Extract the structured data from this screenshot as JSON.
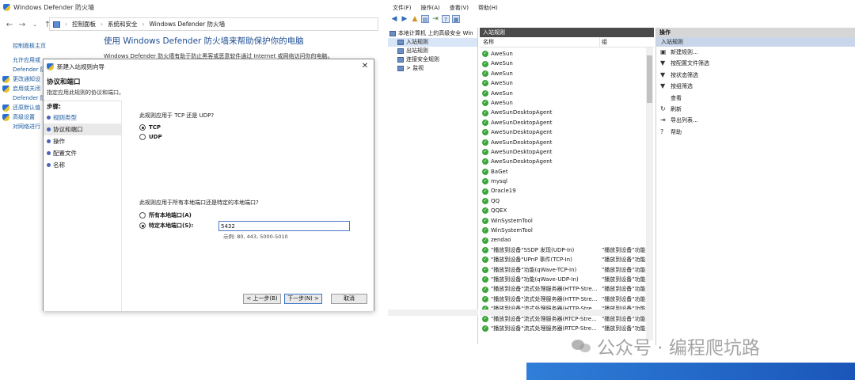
{
  "control_panel": {
    "title": "Windows Defender 防火墙",
    "path": [
      "控制面板",
      "系统和安全",
      "Windows Defender 防火墙"
    ],
    "left_links": [
      {
        "label": "控制面板主页",
        "icon": false
      },
      {
        "label": "允许应用或",
        "icon": false
      },
      {
        "label": "Defender 防",
        "icon": false
      },
      {
        "label": "更改通知设",
        "icon": true
      },
      {
        "label": "启用或关闭",
        "icon": true
      },
      {
        "label": "Defender 防",
        "icon": false
      },
      {
        "label": "还原默认值",
        "icon": true
      },
      {
        "label": "高级设置",
        "icon": true
      },
      {
        "label": "对网络进行",
        "icon": false
      }
    ],
    "heading": "使用 Windows Defender 防火墙来帮助保护你的电脑",
    "description": "Windows Defender 防火墙有助于防止黑客或恶意软件通过 Internet 或网络访问你的电脑。"
  },
  "wizard": {
    "title": "新建入站规则向导",
    "close_label": "✕",
    "header_title": "协议和端口",
    "header_subtitle": "指定应用此规则的协议和端口。",
    "steps_title": "步骤:",
    "steps": [
      "规则类型",
      "协议和端口",
      "操作",
      "配置文件",
      "名称"
    ],
    "q_protocol": "此规则应用于 TCP 还是 UDP?",
    "opt_tcp": "TCP",
    "opt_udp": "UDP",
    "q_ports": "此规则应用于所有本地端口还是特定的本地端口?",
    "opt_all_ports": "所有本地端口(A)",
    "opt_specific_ports": "特定本地端口(S):",
    "port_value": "5432",
    "port_example": "示例: 80, 443, 5000-5010",
    "btn_back": "< 上一步(B)",
    "btn_next": "下一步(N) >",
    "btn_cancel": "取消"
  },
  "mmc": {
    "menu": [
      "文件(F)",
      "操作(A)",
      "查看(V)",
      "帮助(H)"
    ],
    "tree": [
      {
        "label": "本地计算机 上的高级安全 Win",
        "indent": 0,
        "selected": false
      },
      {
        "label": "入站规则",
        "indent": 1,
        "selected": true
      },
      {
        "label": "出站规则",
        "indent": 1,
        "selected": false
      },
      {
        "label": "连接安全规则",
        "indent": 1,
        "selected": false
      },
      {
        "label": "> 监视",
        "indent": 1,
        "selected": false
      }
    ],
    "list_title": "入站规则",
    "col_name": "名称",
    "col_group": "组",
    "rows": [
      {
        "name": "AweSun",
        "group": ""
      },
      {
        "name": "AweSun",
        "group": ""
      },
      {
        "name": "AweSun",
        "group": ""
      },
      {
        "name": "AweSun",
        "group": ""
      },
      {
        "name": "AweSun",
        "group": ""
      },
      {
        "name": "AweSun",
        "group": ""
      },
      {
        "name": "AweSunDesktopAgent",
        "group": ""
      },
      {
        "name": "AweSunDesktopAgent",
        "group": ""
      },
      {
        "name": "AweSunDesktopAgent",
        "group": ""
      },
      {
        "name": "AweSunDesktopAgent",
        "group": ""
      },
      {
        "name": "AweSunDesktopAgent",
        "group": ""
      },
      {
        "name": "AweSunDesktopAgent",
        "group": ""
      },
      {
        "name": "BaGet",
        "group": ""
      },
      {
        "name": "mysql",
        "group": ""
      },
      {
        "name": "Oracle19",
        "group": ""
      },
      {
        "name": "QQ",
        "group": ""
      },
      {
        "name": "QQEX",
        "group": ""
      },
      {
        "name": "WinSystemTool",
        "group": ""
      },
      {
        "name": "WinSystemTool",
        "group": ""
      },
      {
        "name": "zendao",
        "group": ""
      },
      {
        "name": "\"播放到设备\"SSDP 发现(UDP-In)",
        "group": "\"播放到设备\"功能"
      },
      {
        "name": "\"播放到设备\"UPnP 事件(TCP-In)",
        "group": "\"播放到设备\"功能"
      },
      {
        "name": "\"播放到设备\"功能(qWave-TCP-In)",
        "group": "\"播放到设备\"功能"
      },
      {
        "name": "\"播放到设备\"功能(qWave-UDP-In)",
        "group": "\"播放到设备\"功能"
      },
      {
        "name": "\"播放到设备\"流式处理服务器(HTTP-Stre...",
        "group": "\"播放到设备\"功能"
      },
      {
        "name": "\"播放到设备\"流式处理服务器(HTTP-Stre...",
        "group": "\"播放到设备\"功能"
      },
      {
        "name": "\"播放到设备\"流式处理服务器(HTTP-Stre...",
        "group": "\"播放到设备\"功能"
      },
      {
        "name": "\"播放到设备\"流式处理服务器(RTCP-Stre...",
        "group": "\"播放到设备\"功能"
      },
      {
        "name": "\"播放到设备\"流式处理服务器(RTCP-Stre...",
        "group": "\"播放到设备\"功能"
      }
    ],
    "actions_title": "操作",
    "actions_sub": "入站规则",
    "actions": [
      {
        "label": "新建规则...",
        "icon": "new-rule-icon",
        "glyph": "▣"
      },
      {
        "label": "按配置文件筛选",
        "icon": "filter-icon",
        "glyph": "▼"
      },
      {
        "label": "按状态筛选",
        "icon": "filter-icon",
        "glyph": "▼"
      },
      {
        "label": "按组筛选",
        "icon": "filter-icon",
        "glyph": "▼"
      },
      {
        "label": "查看",
        "icon": "",
        "glyph": ""
      },
      {
        "label": "刷新",
        "icon": "refresh-icon",
        "glyph": "↻"
      },
      {
        "label": "导出列表...",
        "icon": "export-icon",
        "glyph": "⇥"
      },
      {
        "label": "帮助",
        "icon": "help-icon",
        "glyph": "?"
      }
    ]
  },
  "watermark": "公众号 · 编程爬坑路"
}
